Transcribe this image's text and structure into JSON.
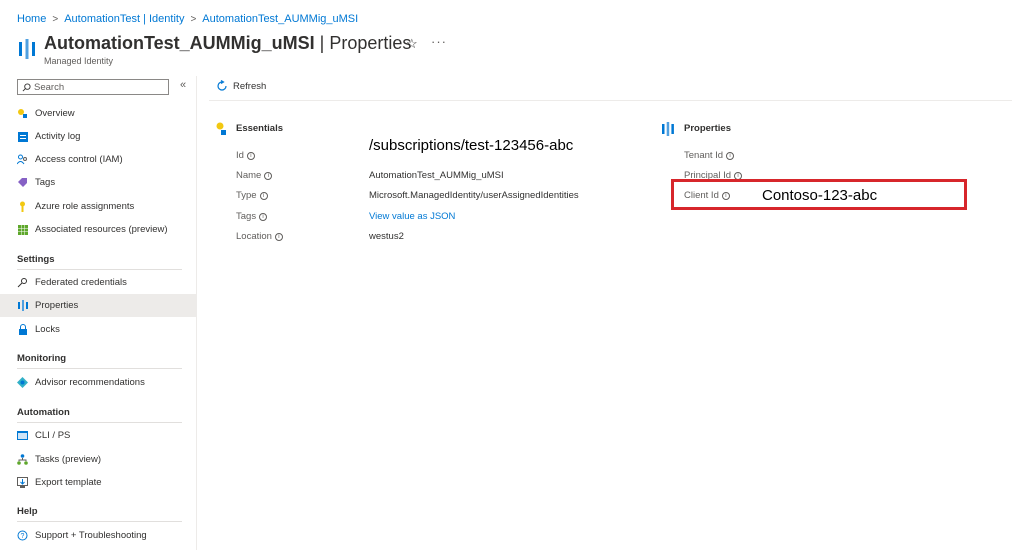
{
  "breadcrumb": {
    "home": "Home",
    "identity": "AutomationTest | Identity",
    "resource": "AutomationTest_AUMMig_uMSI",
    "separator": ">"
  },
  "header": {
    "title_name": "AutomationTest_AUMMig_uMSI",
    "title_section": " | Properties",
    "subtitle": "Managed Identity",
    "favorite_icon": "star-icon",
    "more_label": "···"
  },
  "search": {
    "placeholder": "Search",
    "collapse_label": "«"
  },
  "toolbar": {
    "refresh_label": "Refresh"
  },
  "sidebar": {
    "items_top": [
      {
        "label": "Overview",
        "icon": "overview-icon"
      },
      {
        "label": "Activity log",
        "icon": "activity-log-icon"
      },
      {
        "label": "Access control (IAM)",
        "icon": "people-icon"
      },
      {
        "label": "Tags",
        "icon": "tag-icon"
      },
      {
        "label": "Azure role assignments",
        "icon": "key-icon"
      },
      {
        "label": "Associated resources (preview)",
        "icon": "grid-icon"
      }
    ],
    "settings": {
      "heading": "Settings",
      "items": [
        {
          "label": "Federated credentials",
          "icon": "key-icon"
        },
        {
          "label": "Properties",
          "icon": "properties-icon",
          "active": true
        },
        {
          "label": "Locks",
          "icon": "lock-icon"
        }
      ]
    },
    "monitoring": {
      "heading": "Monitoring",
      "items": [
        {
          "label": "Advisor recommendations",
          "icon": "advisor-icon"
        }
      ]
    },
    "automation": {
      "heading": "Automation",
      "items": [
        {
          "label": "CLI / PS",
          "icon": "terminal-icon"
        },
        {
          "label": "Tasks (preview)",
          "icon": "tasks-icon"
        },
        {
          "label": "Export template",
          "icon": "export-icon"
        }
      ]
    },
    "help": {
      "heading": "Help",
      "items": [
        {
          "label": "Support + Troubleshooting",
          "icon": "help-icon"
        }
      ]
    }
  },
  "essentials": {
    "title": "Essentials",
    "id_label": "Id",
    "id_value": "/subscriptions/test-123456-abc",
    "name_label": "Name",
    "name_value": "AutomationTest_AUMMig_uMSI",
    "type_label": "Type",
    "type_value": "Microsoft.ManagedIdentity/userAssignedIdentities",
    "tags_label": "Tags",
    "tags_value": "View value as JSON",
    "location_label": "Location",
    "location_value": "westus2"
  },
  "properties": {
    "title": "Properties",
    "tenant_label": "Tenant Id",
    "principal_label": "Principal Id",
    "client_label": "Client Id",
    "client_value": "Contoso-123-abc"
  },
  "colors": {
    "accent": "#0078d4",
    "highlight_border": "#d7262b",
    "active_bg": "#edebe9"
  }
}
